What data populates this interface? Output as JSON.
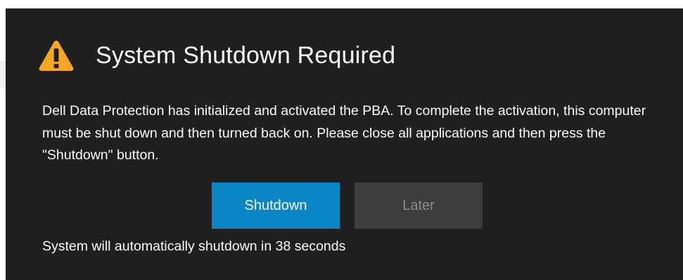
{
  "dialog": {
    "title": "System Shutdown Required",
    "icon": "warning-icon",
    "message": "Dell Data Protection has initialized and activated the PBA.  To complete the activation, this computer must be shut down and then turned back on.  Please close all applications and then press the \"Shutdown\" button.",
    "buttons": {
      "shutdown_label": "Shutdown",
      "later_label": "Later"
    },
    "countdown_text": "System will automatically shutdown in 38 seconds"
  },
  "colors": {
    "background": "#1f1f1f",
    "primary_button": "#0a85c5",
    "secondary_button": "#3d3d3d",
    "warning": "#f5a623"
  }
}
